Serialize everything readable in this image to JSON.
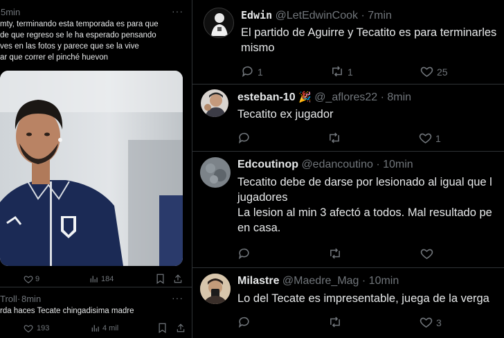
{
  "left_post": {
    "time": "5min",
    "text_lines": [
      "mty, terminando esta temporada es para que",
      "de que regreso se le ha esperado pensando",
      "ves en las fotos y parece que se la vive",
      "ar que correr el pinché huevon"
    ],
    "likes": "9",
    "views": "184"
  },
  "left_post2": {
    "author": "Troll",
    "time": "8min",
    "text": "rda haces Tecate chingadisima madre",
    "likes": "193",
    "views": "4 mil"
  },
  "replies": [
    {
      "name": "Edwin",
      "handle": "@LetEdwinCook",
      "time": "7min",
      "text_lines": [
        "El partido de Aguirre y Tecatito es para terminarles",
        "mismo"
      ],
      "replies": "1",
      "retweets": "1",
      "likes": "25"
    },
    {
      "name": "esteban-10",
      "emoji": "🎉",
      "handle": "@_aflores22",
      "time": "8min",
      "text_lines": [
        "Tecatito ex jugador"
      ],
      "replies": "",
      "retweets": "",
      "likes": "1"
    },
    {
      "name": "Edcoutinop",
      "handle": "@edancoutino",
      "time": "10min",
      "text_lines": [
        "Tecatito debe de darse por lesionado al igual que l",
        "jugadores",
        "La lesion al min 3 afectó a todos. Mal resultado pe",
        "en casa."
      ],
      "replies": "",
      "retweets": "",
      "likes": ""
    },
    {
      "name": "Milastre",
      "handle": "@Maedre_Mag",
      "time": "10min",
      "text_lines": [
        "Lo del Tecate es impresentable, juega de la verga"
      ],
      "replies": "",
      "retweets": "",
      "likes": "3"
    }
  ],
  "ui": {
    "more": "···",
    "dot": "·"
  },
  "colors": {
    "bg": "#000000",
    "text": "#e7e9ea",
    "dim": "#71767b",
    "border": "#2f3336",
    "jersey": "#1b2a55"
  }
}
